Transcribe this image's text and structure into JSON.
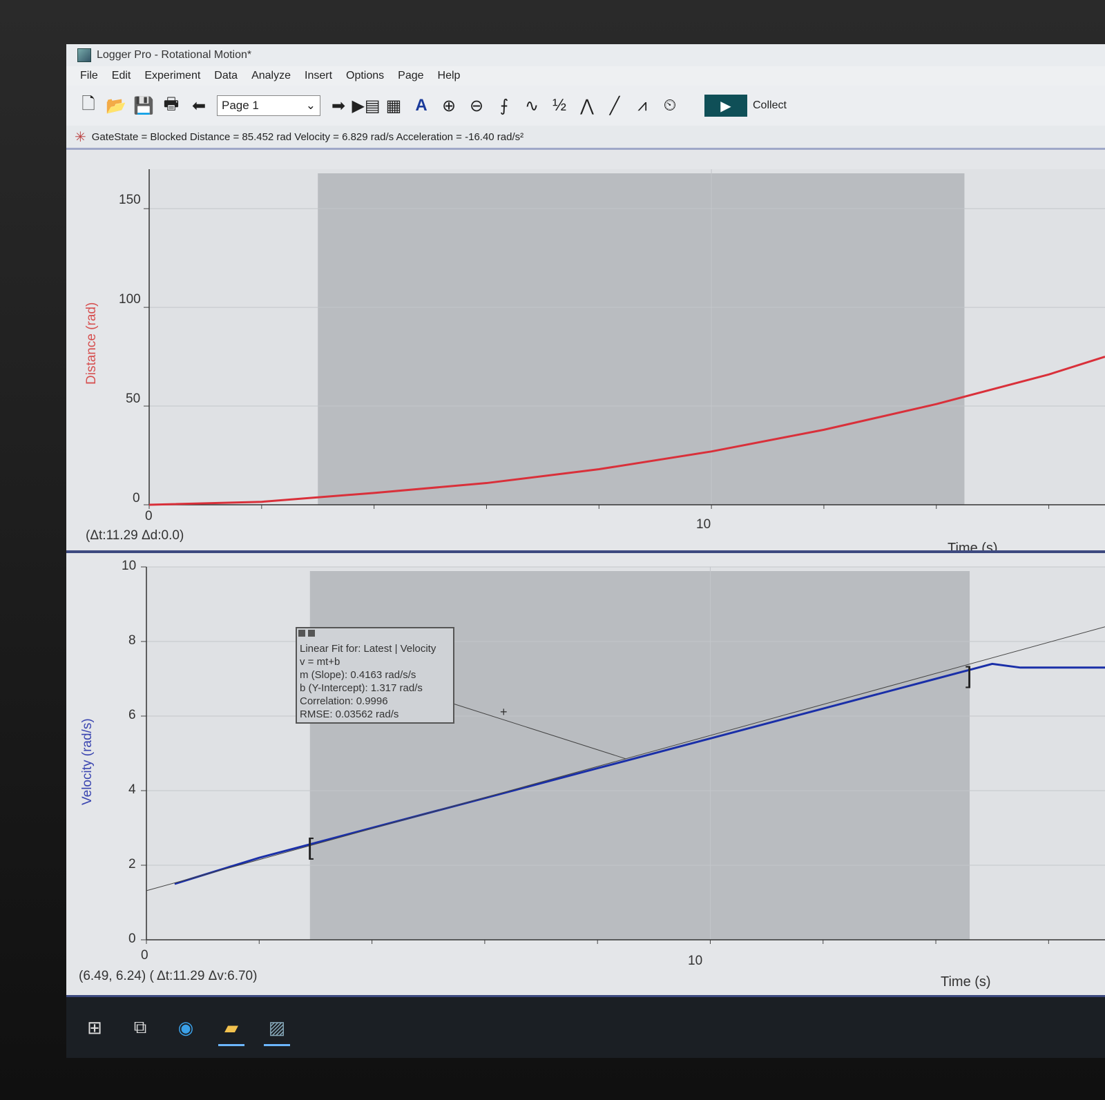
{
  "window": {
    "title": "Logger Pro - Rotational Motion*"
  },
  "menu": [
    "File",
    "Edit",
    "Experiment",
    "Data",
    "Analyze",
    "Insert",
    "Options",
    "Page",
    "Help"
  ],
  "toolbar": {
    "page_select": "Page 1",
    "collect_label": "Collect",
    "icons": [
      "new-file-icon",
      "open-folder-icon",
      "save-icon",
      "print-icon",
      "back-arrow-icon",
      "forward-arrow-icon",
      "data-browser-icon",
      "calculator-icon",
      "autoscale-icon",
      "zoom-in-icon",
      "zoom-out-icon",
      "examine-icon",
      "tangent-icon",
      "integral-icon",
      "statistics-icon",
      "linear-fit-icon",
      "curve-fit-icon",
      "replay-icon"
    ]
  },
  "status": {
    "text": "GateState = Blocked Distance = 85.452 rad Velocity = 6.829 rad/s Acceleration = -16.40 rad/s²"
  },
  "graph1": {
    "ylabel": "Distance (rad)",
    "xlabel": "Time (s)",
    "readout": "(Δt:11.29 Δd:0.0)",
    "yticks": [
      "150",
      "100",
      "50",
      "0"
    ],
    "xticks": [
      "0",
      "10"
    ],
    "line_color": "#d9303a"
  },
  "graph2": {
    "ylabel": "Velocity (rad/s)",
    "xlabel": "Time (s)",
    "readout": "(6.49, 6.24) ( Δt:11.29 Δv:6.70)",
    "yticks": [
      "10",
      "8",
      "6",
      "4",
      "2",
      "0"
    ],
    "xticks": [
      "0",
      "10"
    ],
    "line_color": "#1a2fa8"
  },
  "fit": {
    "line1": "Linear Fit for: Latest | Velocity",
    "line2": "v = mt+b",
    "line3": "m (Slope): 0.4163 rad/s/s",
    "line4": "b (Y-Intercept): 1.317 rad/s",
    "line5": "Correlation: 0.9996",
    "line6": "RMSE: 0.03562 rad/s"
  },
  "chart_data": [
    {
      "type": "line",
      "ylabel": "Distance (rad)",
      "xlabel": "Time (s)",
      "xlim": [
        0,
        17
      ],
      "ylim": [
        0,
        170
      ],
      "series": [
        {
          "x": [
            0,
            2,
            4,
            6,
            8,
            10,
            12,
            14,
            16,
            17
          ],
          "values": [
            0,
            1.5,
            6,
            11,
            18,
            27,
            38,
            51,
            66,
            75
          ]
        }
      ]
    },
    {
      "type": "line",
      "ylabel": "Velocity (rad/s)",
      "xlabel": "Time (s)",
      "xlim": [
        0,
        17
      ],
      "ylim": [
        0,
        10
      ],
      "series": [
        {
          "x": [
            0.5,
            2,
            4,
            6,
            8,
            10,
            12,
            14,
            14.5,
            15,
            15.5,
            16,
            17
          ],
          "values": [
            1.5,
            2.2,
            3.0,
            3.8,
            4.6,
            5.4,
            6.2,
            7.0,
            7.2,
            7.4,
            7.3,
            7.3,
            7.3
          ]
        }
      ]
    }
  ]
}
